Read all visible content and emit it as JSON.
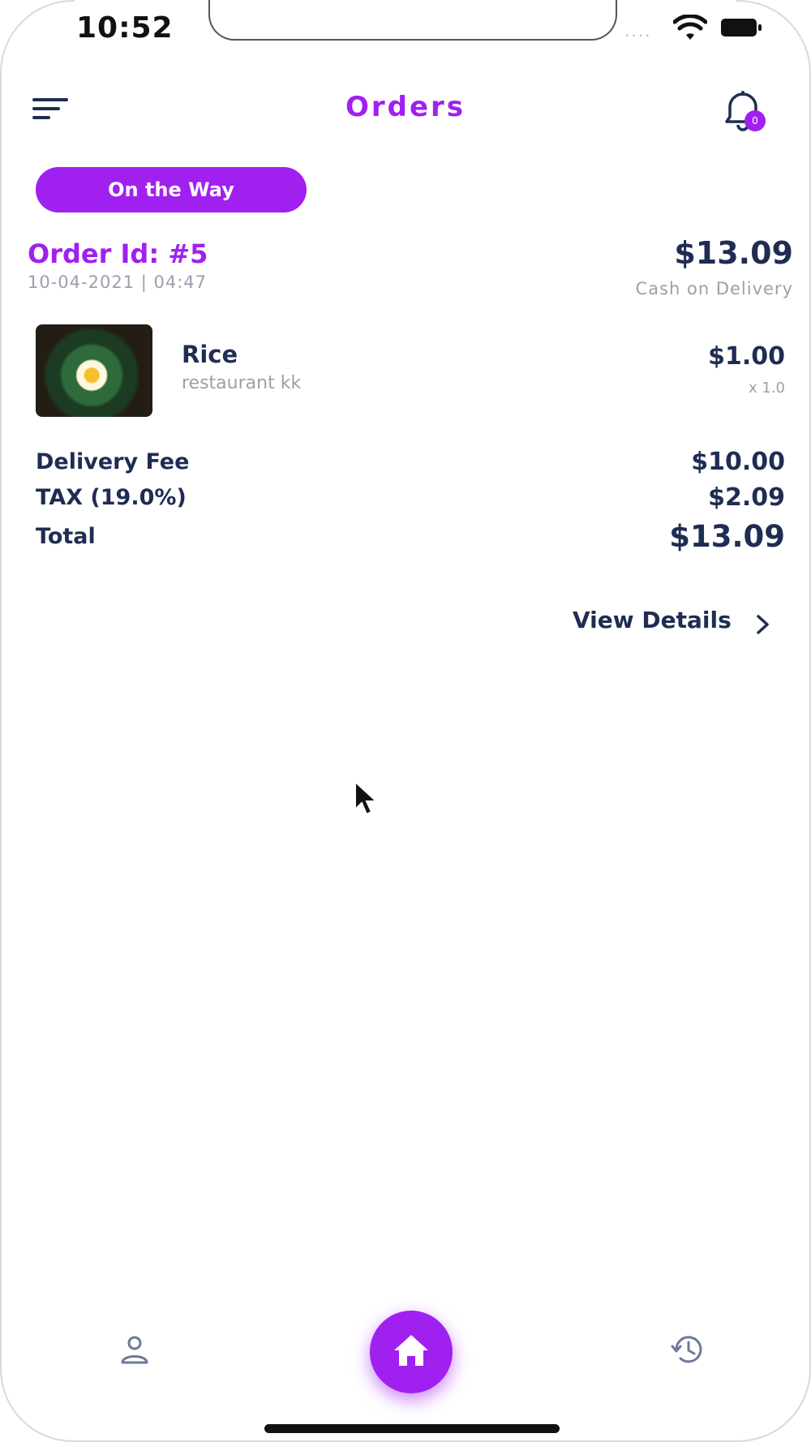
{
  "status_bar": {
    "time": "10:52",
    "signal_dots": "····"
  },
  "header": {
    "title": "Orders",
    "notification_count": "0"
  },
  "order": {
    "status_label": "On the Way",
    "id_label": "Order Id: #5",
    "datetime": "10-04-2021 | 04:47",
    "total": "$13.09",
    "payment_method": "Cash on Delivery",
    "item": {
      "name": "Rice",
      "restaurant": "restaurant kk",
      "price": "$1.00",
      "quantity": "x 1.0"
    },
    "delivery_fee_label": "Delivery Fee",
    "delivery_fee": "$10.00",
    "tax_label": "TAX (19.0%)",
    "tax": "$2.09",
    "total_label": "Total",
    "grand_total": "$13.09",
    "view_details_label": "View Details"
  },
  "colors": {
    "accent": "#a020f0",
    "text_dark": "#1f2d52",
    "text_muted": "#9aa0ad"
  },
  "icons": {
    "menu": "menu-icon",
    "bell": "bell-icon",
    "profile": "user-icon",
    "home": "home-icon",
    "history": "history-icon"
  }
}
